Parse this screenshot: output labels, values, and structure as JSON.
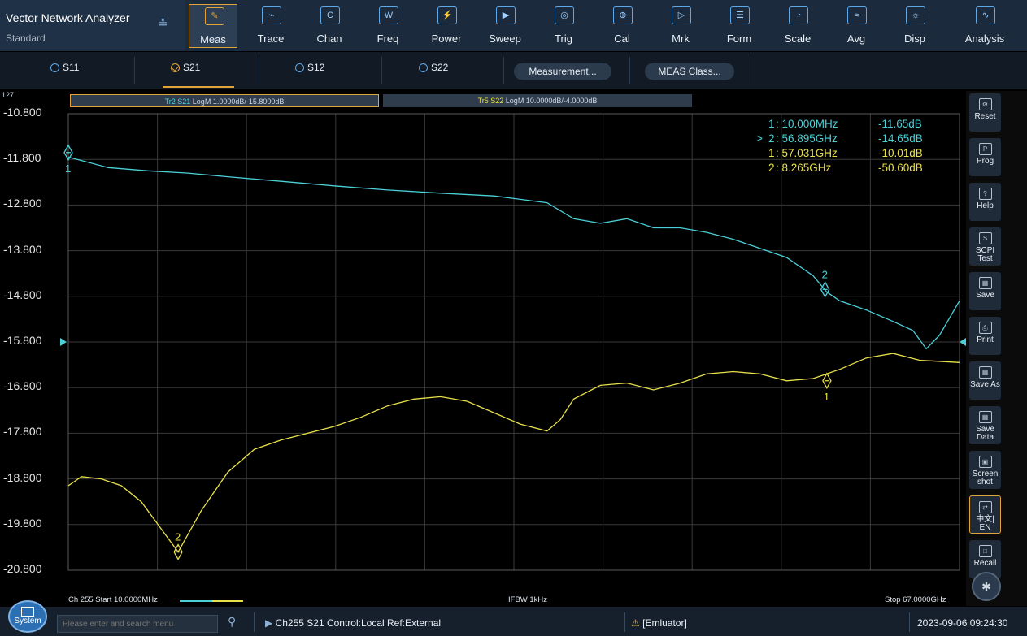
{
  "app": {
    "title": "Vector Network Analyzer",
    "subtitle": "Standard"
  },
  "toolbar": [
    {
      "label": "Meas",
      "icon": "meas-icon",
      "active": true
    },
    {
      "label": "Trace",
      "icon": "trace-icon"
    },
    {
      "label": "Chan",
      "icon": "chan-icon"
    },
    {
      "label": "Freq",
      "icon": "freq-icon"
    },
    {
      "label": "Power",
      "icon": "power-icon"
    },
    {
      "label": "Sweep",
      "icon": "sweep-icon"
    },
    {
      "label": "Trig",
      "icon": "trig-icon"
    },
    {
      "label": "Cal",
      "icon": "cal-icon"
    },
    {
      "label": "Mrk",
      "icon": "mrk-icon"
    },
    {
      "label": "Form",
      "icon": "form-icon"
    },
    {
      "label": "Scale",
      "icon": "scale-icon"
    },
    {
      "label": "Avg",
      "icon": "avg-icon"
    },
    {
      "label": "Disp",
      "icon": "disp-icon"
    },
    {
      "label": "Analysis",
      "icon": "analysis-icon"
    }
  ],
  "sparams": [
    {
      "label": "S11",
      "selected": false
    },
    {
      "label": "S21",
      "selected": true
    },
    {
      "label": "S12",
      "selected": false
    },
    {
      "label": "S22",
      "selected": false
    }
  ],
  "pills": {
    "measurement": "Measurement...",
    "meas_class": "MEAS Class..."
  },
  "window_number": "127",
  "traces": {
    "tr2": {
      "name": "Tr2 S21",
      "info": "LogM 1.0000dB/-15.8000dB",
      "color": "#4ad0d8"
    },
    "tr5": {
      "name": "Tr5 S22",
      "info": "LogM 10.0000dB/-4.0000dB",
      "color": "#e8e04a"
    }
  },
  "y_axis_labels": [
    "-10.800",
    "-11.800",
    "-12.800",
    "-13.800",
    "-14.800",
    "-15.800",
    "-16.800",
    "-17.800",
    "-18.800",
    "-19.800",
    "-20.800"
  ],
  "markers_table": [
    {
      "prefix": "",
      "num": "1",
      "freq": ": 10.000MHz",
      "value": "-11.65dB",
      "color": "#4ad0d8"
    },
    {
      "prefix": ">",
      "num": "2",
      "freq": ": 56.895GHz",
      "value": "-14.65dB",
      "color": "#4ad0d8"
    },
    {
      "prefix": "",
      "num": "1",
      "freq": ": 57.031GHz",
      "value": "-10.01dB",
      "color": "#e8e04a"
    },
    {
      "prefix": "",
      "num": "2",
      "freq": ": 8.265GHz",
      "value": "-50.60dB",
      "color": "#e8e04a"
    }
  ],
  "footer": {
    "start": "Ch 255 Start 10.0000MHz",
    "ifbw": "IFBW 1kHz",
    "stop": "Stop 67.0000GHz"
  },
  "right_panel": [
    {
      "label": "Reset",
      "icon": "reset-icon"
    },
    {
      "label": "Prog",
      "icon": "prog-icon"
    },
    {
      "label": "Help",
      "icon": "help-icon"
    },
    {
      "label": "SCPI Test",
      "icon": "scpi-icon"
    },
    {
      "label": "Save",
      "icon": "save-icon"
    },
    {
      "label": "Print",
      "icon": "print-icon"
    },
    {
      "label": "Save As",
      "icon": "save-as-icon"
    },
    {
      "label": "Save Data",
      "icon": "save-data-icon"
    },
    {
      "label": "Screen shot",
      "icon": "screenshot-icon"
    },
    {
      "label": "中文| EN",
      "icon": "language-icon",
      "selected": true
    },
    {
      "label": "Recall",
      "icon": "recall-icon"
    }
  ],
  "status": {
    "system_label": "System",
    "search_placeholder": "Please enter and search menu",
    "channel_info": "Ch255 S21 Control:Local Ref:External",
    "emulator": "[Emluator]",
    "datetime": "2023-09-06 09:24:30"
  },
  "chart_data": {
    "type": "line",
    "xlabel": "",
    "ylabel": "",
    "ylim": [
      -20.8,
      -10.8
    ],
    "y_ticks": [
      -10.8,
      -11.8,
      -12.8,
      -13.8,
      -14.8,
      -15.8,
      -16.8,
      -17.8,
      -18.8,
      -19.8,
      -20.8
    ],
    "grid": true,
    "x_range_GHz": [
      0.01,
      67.0
    ],
    "reference_level_dB": -15.8,
    "series": [
      {
        "name": "Tr2 S21",
        "color": "#4ad0d8",
        "x_GHz": [
          0.01,
          3,
          6,
          9,
          12,
          16,
          20,
          24,
          28,
          32,
          36,
          38,
          40,
          42,
          44,
          46,
          48,
          50,
          52,
          54,
          56,
          57,
          58,
          60,
          62,
          63.5,
          64.5,
          65.5,
          66.2,
          67
        ],
        "y_dB": [
          -11.75,
          -11.98,
          -12.05,
          -12.1,
          -12.18,
          -12.28,
          -12.38,
          -12.47,
          -12.54,
          -12.6,
          -12.75,
          -13.1,
          -13.2,
          -13.1,
          -13.3,
          -13.3,
          -13.4,
          -13.55,
          -13.75,
          -13.95,
          -14.35,
          -14.7,
          -14.9,
          -15.1,
          -15.35,
          -15.55,
          -15.95,
          -15.65,
          -15.3,
          -14.9
        ]
      },
      {
        "name": "Tr5 S22",
        "color": "#e8e04a",
        "x_GHz": [
          0.01,
          1,
          2.5,
          4,
          5.5,
          7,
          8.265,
          10,
          12,
          14,
          16,
          18,
          20,
          22,
          24,
          26,
          28,
          30,
          32,
          34,
          36,
          37,
          38,
          40,
          42,
          44,
          46,
          48,
          50,
          52,
          54,
          56,
          58,
          60,
          62,
          64,
          67
        ],
        "y_dB": [
          -18.95,
          -18.75,
          -18.8,
          -18.95,
          -19.3,
          -19.9,
          -20.4,
          -19.5,
          -18.65,
          -18.15,
          -17.95,
          -17.8,
          -17.65,
          -17.45,
          -17.2,
          -17.05,
          -17.0,
          -17.1,
          -17.35,
          -17.6,
          -17.75,
          -17.5,
          -17.05,
          -16.75,
          -16.7,
          -16.85,
          -16.7,
          -16.5,
          -16.45,
          -16.5,
          -16.65,
          -16.6,
          -16.4,
          -16.15,
          -16.05,
          -16.2,
          -16.25
        ]
      }
    ],
    "markers": [
      {
        "trace": "Tr2 S21",
        "label": "1",
        "x_GHz": 0.01,
        "y_dB": -11.65
      },
      {
        "trace": "Tr2 S21",
        "label": "2",
        "x_GHz": 56.895,
        "y_dB": -14.65
      },
      {
        "trace": "Tr5 S22",
        "label": "1",
        "x_GHz": 57.031,
        "y_dB": -16.65
      },
      {
        "trace": "Tr5 S22",
        "label": "2",
        "x_GHz": 8.265,
        "y_dB": -20.4
      }
    ]
  }
}
